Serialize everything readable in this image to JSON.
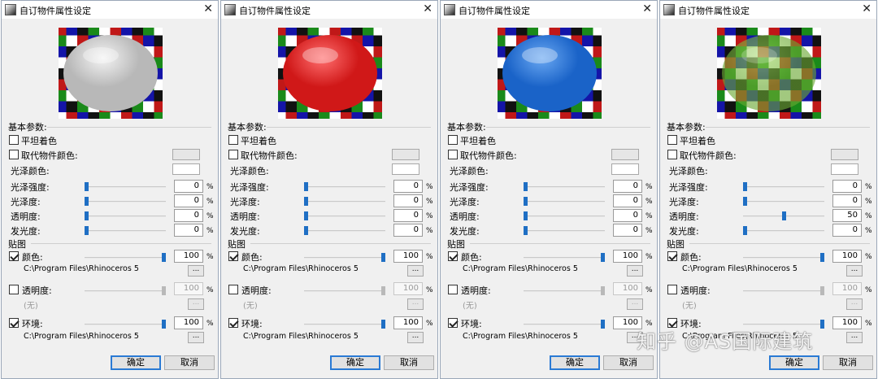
{
  "dialogs": [
    {
      "title": "自订物件属性设定",
      "ball_color": "#b8b8b8",
      "ball_highlight": "#f4f4f4",
      "transparency_value": "0",
      "transparency_level": 0,
      "swatches": [
        "#e6e6e6",
        "#ffffff"
      ]
    },
    {
      "title": "自订物件属性设定",
      "ball_color": "#d01818",
      "ball_highlight": "#ff6f6f",
      "transparency_value": "0",
      "transparency_level": 0,
      "swatches": [
        "#e6e6e6",
        "#ffffff"
      ]
    },
    {
      "title": "自订物件属性设定",
      "ball_color": "#1a63c8",
      "ball_highlight": "#6aa8f2",
      "transparency_value": "0",
      "transparency_level": 0,
      "swatches": [
        "#e6e6e6",
        "#ffffff"
      ]
    },
    {
      "title": "自订物件属性设定",
      "ball_color": "#6aa832",
      "ball_highlight": "#9cd85a",
      "transparency_value": "50",
      "transparency_level": 0.5,
      "swatches": [
        "#e6e6e6",
        "#ffffff"
      ]
    }
  ],
  "labels": {
    "basic_params": "基本参数:",
    "flat_shading": "平坦着色",
    "override_color": "取代物件颜色:",
    "gloss_color": "光泽颜色:",
    "gloss_intensity": "光泽强度:",
    "glossiness": "光泽度:",
    "transparency": "透明度:",
    "luminosity": "发光度:",
    "texture": "贴图",
    "color_map": "颜色:",
    "transparency_map": "透明度:",
    "environment_map": "环境:",
    "percent": "%",
    "ellipsis": "...",
    "none": "(无)",
    "ok": "确定",
    "cancel": "取消",
    "close": "✕"
  },
  "values": {
    "gloss_intensity": "0",
    "glossiness": "0",
    "luminosity": "0",
    "color_map_strength": "100",
    "transparency_map_strength": "100",
    "environment_map_strength": "100"
  },
  "paths": {
    "color_map": "C:\\Program Files\\Rhinoceros 5",
    "environment_map": "C:\\Program Files\\Rhinoceros 5"
  },
  "checkboxes": {
    "flat_shading": false,
    "override_color": false,
    "color_map": true,
    "transparency_map": false,
    "environment_map": true
  },
  "checker_colors": [
    "#c01818",
    "#1a8a1a",
    "#1414a8",
    "#ffffff",
    "#111111"
  ],
  "icons": {
    "app": "rhino-icon",
    "close": "close-icon"
  },
  "watermark": "知乎 @AS国际建筑"
}
